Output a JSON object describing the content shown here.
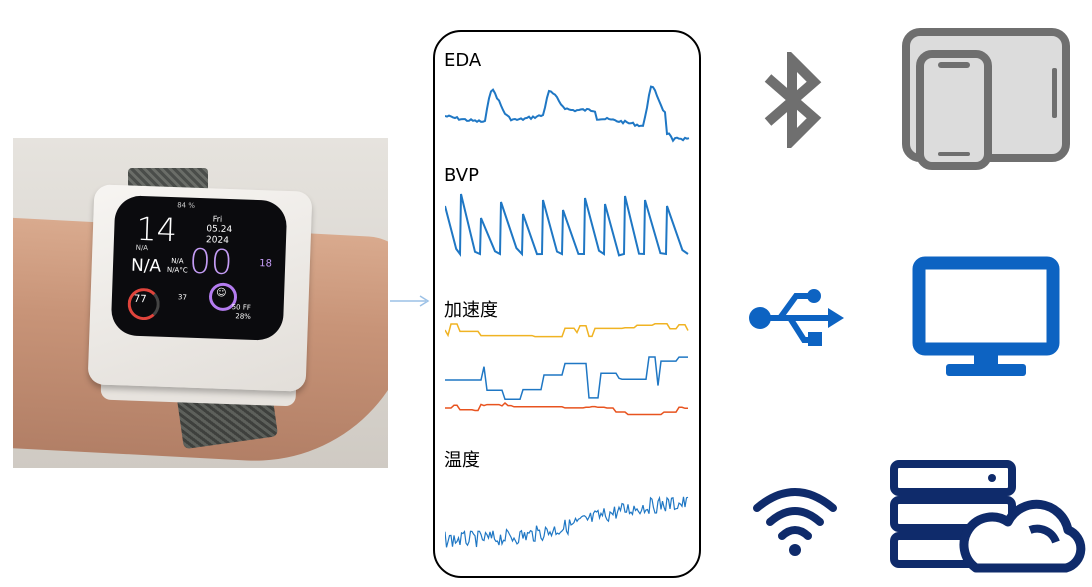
{
  "signals": {
    "eda": "EDA",
    "bvp": "BVP",
    "acc": "加速度",
    "temp": "温度"
  },
  "watch_screen": {
    "battery": "84 %",
    "hour": "14",
    "minutes": "00",
    "day": "Fri",
    "date": "05.24",
    "year": "2024",
    "location": "N/A",
    "big_na": "N/A",
    "small_na_1": "N/A",
    "small_na_2": "N/A°C",
    "seconds": "18",
    "heart": "77",
    "steps": "37",
    "temp": "50 FF",
    "pct": "28%"
  },
  "colors": {
    "signal_blue": "#1f77c4",
    "acc_orange": "#f0b323",
    "acc_red": "#e8531f",
    "device_gray": "#6f6f6f",
    "computer_blue": "#0d63c2",
    "server_navy": "#0f2b6b",
    "arrow": "#9cc1e6"
  },
  "icons": [
    "bluetooth-icon",
    "tablet-phone-icon",
    "usb-icon",
    "monitor-icon",
    "wifi-icon",
    "cloud-server-icon"
  ]
}
